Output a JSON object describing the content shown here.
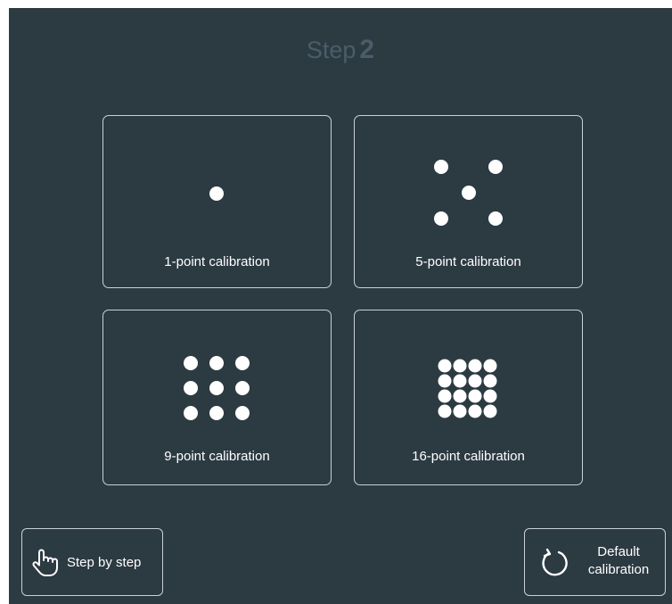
{
  "header": {
    "step_word": "Step",
    "step_number": "2"
  },
  "options": [
    {
      "label": "1-point calibration",
      "points": 1
    },
    {
      "label": "5-point calibration",
      "points": 5
    },
    {
      "label": "9-point calibration",
      "points": 9
    },
    {
      "label": "16-point calibration",
      "points": 16
    }
  ],
  "footer": {
    "step_by_step_label": "Step by step",
    "step_by_step_icon": "pointing-hand-icon",
    "default_label_line1": "Default",
    "default_label_line2": "calibration",
    "default_icon": "reset-icon"
  },
  "colors": {
    "background": "#2c3a42",
    "title": "#4a5d68",
    "border": "#c9d1d6",
    "dot": "#ffffff"
  }
}
